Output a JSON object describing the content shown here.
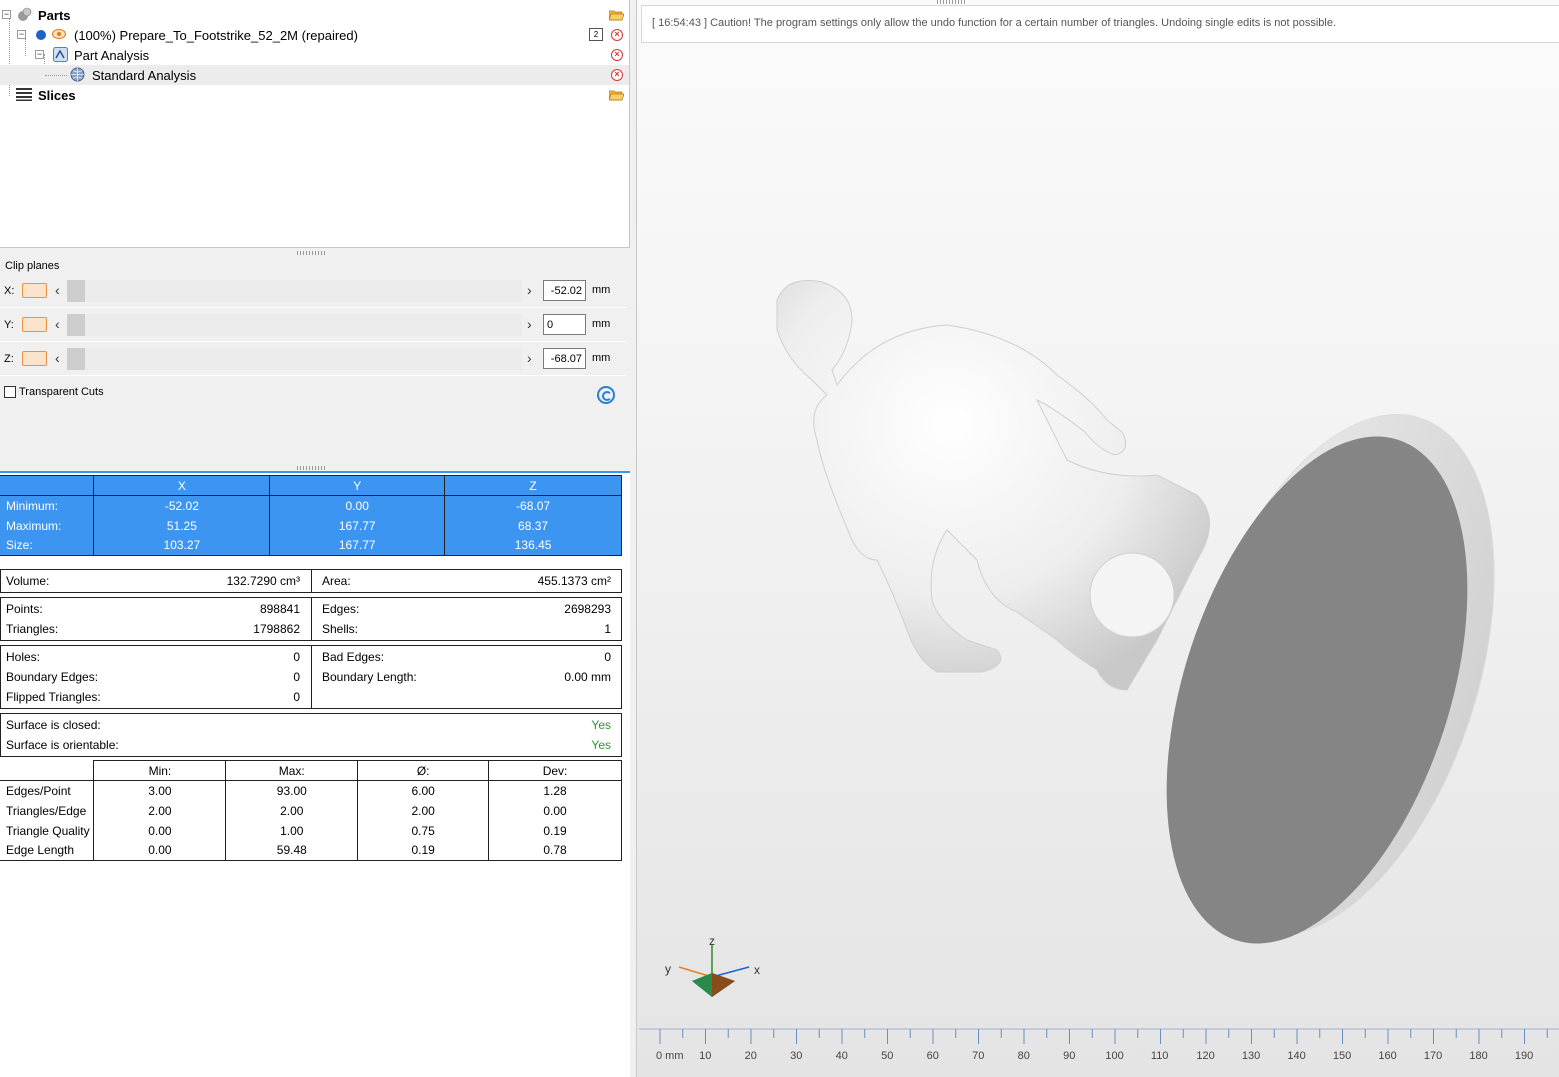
{
  "tree": {
    "parts_label": "Parts",
    "part_name": "(100%) Prepare_To_Footstrike_52_2M (repaired)",
    "part_badge": "2",
    "analysis_label": "Part Analysis",
    "standard_label": "Standard Analysis",
    "slices_label": "Slices"
  },
  "clip": {
    "title": "Clip planes",
    "rows": [
      {
        "axis": "X:",
        "value": "-52.02",
        "unit": "mm"
      },
      {
        "axis": "Y:",
        "value": "0",
        "unit": "mm"
      },
      {
        "axis": "Z:",
        "value": "-68.07",
        "unit": "mm"
      }
    ],
    "transparent_label": "Transparent Cuts"
  },
  "bbox": {
    "headers": [
      "X",
      "Y",
      "Z"
    ],
    "rows": [
      {
        "label": "Minimum:",
        "x": "-52.02",
        "y": "0.00",
        "z": "-68.07"
      },
      {
        "label": "Maximum:",
        "x": "51.25",
        "y": "167.77",
        "z": "68.37"
      },
      {
        "label": "Size:",
        "x": "103.27",
        "y": "167.77",
        "z": "136.45"
      }
    ]
  },
  "measures": {
    "volume_label": "Volume:",
    "volume_value": "132.7290 cm³",
    "area_label": "Area:",
    "area_value": "455.1373 cm²",
    "points_label": "Points:",
    "points_value": "898841",
    "triangles_label": "Triangles:",
    "triangles_value": "1798862",
    "edges_label": "Edges:",
    "edges_value": "2698293",
    "shells_label": "Shells:",
    "shells_value": "1",
    "holes_label": "Holes:",
    "holes_value": "0",
    "boundary_edges_label": "Boundary Edges:",
    "boundary_edges_value": "0",
    "flipped_label": "Flipped Triangles:",
    "flipped_value": "0",
    "bad_edges_label": "Bad Edges:",
    "bad_edges_value": "0",
    "boundary_length_label": "Boundary Length:",
    "boundary_length_value": "0.00 mm",
    "closed_label": "Surface is closed:",
    "closed_value": "Yes",
    "orientable_label": "Surface is orientable:",
    "orientable_value": "Yes"
  },
  "stats": {
    "headers": [
      "Min:",
      "Max:",
      "Ø:",
      "Dev:"
    ],
    "rows": [
      {
        "label": "Edges/Point",
        "min": "3.00",
        "max": "93.00",
        "avg": "6.00",
        "dev": "1.28"
      },
      {
        "label": "Triangles/Edge",
        "min": "2.00",
        "max": "2.00",
        "avg": "2.00",
        "dev": "0.00"
      },
      {
        "label": "Triangle Quality",
        "min": "0.00",
        "max": "1.00",
        "avg": "0.75",
        "dev": "0.19"
      },
      {
        "label": "Edge Length",
        "min": "0.00",
        "max": "59.48",
        "avg": "0.19",
        "dev": "0.78"
      }
    ]
  },
  "viewport": {
    "message": "[ 16:54:43 ] Caution! The program settings only allow the undo function for a certain number of triangles. Undoing single edits is not possible.",
    "axis_labels": {
      "x": "x",
      "y": "y",
      "z": "z"
    },
    "ruler_labels": [
      "0 mm",
      "10",
      "20",
      "30",
      "40",
      "50",
      "60",
      "70",
      "80",
      "90",
      "100",
      "110",
      "120",
      "130",
      "140",
      "150",
      "160",
      "170",
      "180",
      "190"
    ]
  },
  "colors": {
    "selection_blue": "#3c95f0",
    "yes_green": "#2a9a2a",
    "clip_orange": "#f0923c"
  }
}
